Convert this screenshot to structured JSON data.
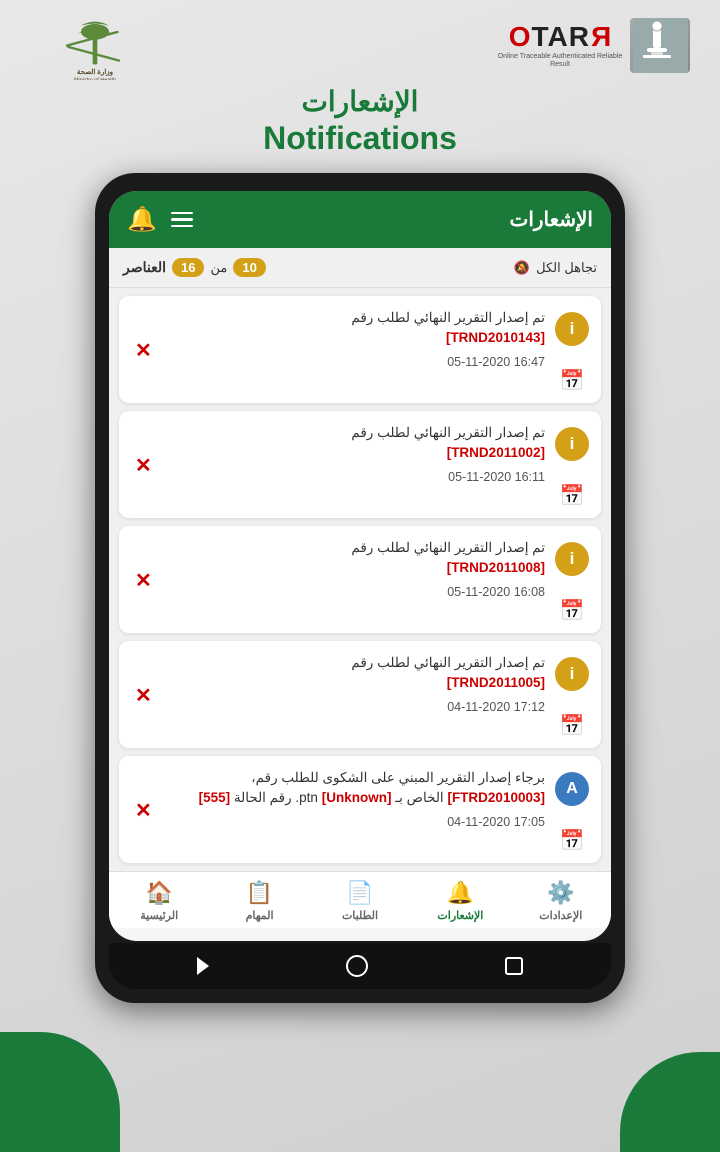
{
  "header": {
    "moh_ar": "وزارة الصحة",
    "moh_en": "Ministry of Health",
    "otara_brand": "OTARA",
    "otara_subtitle": "Online Traceable Authenticated Reliable Result",
    "page_title_ar": "الإشعارات",
    "page_title_en": "Notifications"
  },
  "app_header": {
    "title": "الإشعارات",
    "bell_icon": "🔔",
    "menu_icon": "≡"
  },
  "toolbar": {
    "elements_label": "العناصر",
    "count_shown": "10",
    "count_of_text": "من",
    "count_total": "16",
    "ignore_all_label": "تجاهل الكل",
    "ignore_icon": "🔔"
  },
  "notifications": [
    {
      "id": "n1",
      "message": "تم إصدار التقرير النهائي لطلب رقم",
      "ref": "[TRND2010143]",
      "date": "05-11-2020 16:47",
      "type": "info"
    },
    {
      "id": "n2",
      "message": "تم إصدار التقرير النهائي لطلب رقم",
      "ref": "[TRND2011002]",
      "date": "05-11-2020 16:11",
      "type": "info"
    },
    {
      "id": "n3",
      "message": "تم إصدار التقرير النهائي لطلب رقم",
      "ref": "[TRND2011008]",
      "date": "05-11-2020 16:08",
      "type": "info"
    },
    {
      "id": "n4",
      "message": "تم إصدار التقرير النهائي لطلب رقم",
      "ref": "[TRND2011005]",
      "date": "04-11-2020 17:12",
      "type": "info"
    },
    {
      "id": "n5",
      "message": "برجاء إصدار التقرير المبني على الشكوى للطلب رقم، [FTRD2010003] الخاص بـ [Unknown] ptn. رقم الحالة [555]",
      "ref": "",
      "date": "04-11-2020 17:05",
      "type": "avatar"
    }
  ],
  "bottom_nav": [
    {
      "id": "home",
      "label": "الرئيسية",
      "icon": "🏠",
      "active": false
    },
    {
      "id": "tasks",
      "label": "المهام",
      "icon": "📋",
      "active": false
    },
    {
      "id": "requests",
      "label": "الطلبات",
      "icon": "📄",
      "active": false
    },
    {
      "id": "notifications",
      "label": "الإشعارات",
      "icon": "🔔",
      "active": true
    },
    {
      "id": "settings",
      "label": "الإعدادات",
      "icon": "⚙️",
      "active": false
    }
  ]
}
